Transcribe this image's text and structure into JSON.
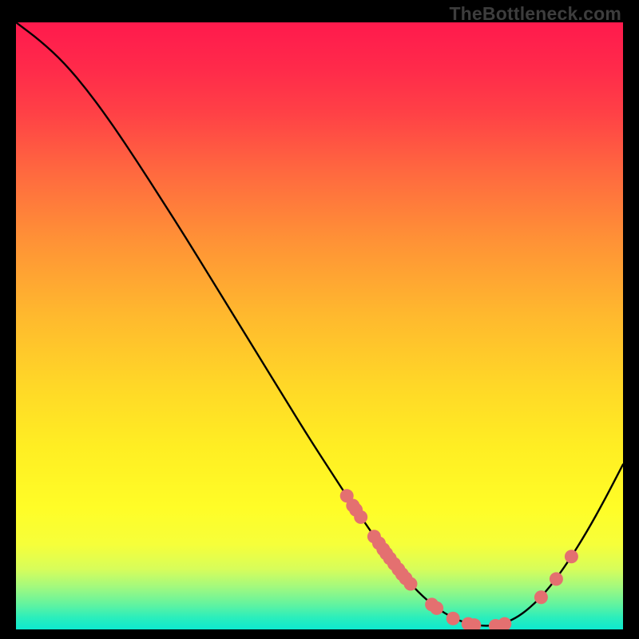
{
  "watermark": "TheBottleneck.com",
  "chart_data": {
    "type": "line",
    "title": "",
    "xlabel": "",
    "ylabel": "",
    "xlim": [
      0,
      100
    ],
    "ylim": [
      0,
      100
    ],
    "grid": false,
    "legend": false,
    "curve": [
      {
        "x": 0.0,
        "y": 100.0
      },
      {
        "x": 4.0,
        "y": 97.0
      },
      {
        "x": 8.0,
        "y": 93.3
      },
      {
        "x": 12.0,
        "y": 88.5
      },
      {
        "x": 16.0,
        "y": 83.0
      },
      {
        "x": 20.0,
        "y": 77.0
      },
      {
        "x": 24.0,
        "y": 70.8
      },
      {
        "x": 28.0,
        "y": 64.5
      },
      {
        "x": 32.0,
        "y": 58.0
      },
      {
        "x": 36.0,
        "y": 51.5
      },
      {
        "x": 40.0,
        "y": 45.0
      },
      {
        "x": 44.0,
        "y": 38.5
      },
      {
        "x": 48.0,
        "y": 32.0
      },
      {
        "x": 52.0,
        "y": 25.8
      },
      {
        "x": 55.0,
        "y": 21.2
      },
      {
        "x": 58.0,
        "y": 16.8
      },
      {
        "x": 61.0,
        "y": 12.5
      },
      {
        "x": 64.0,
        "y": 8.6
      },
      {
        "x": 67.0,
        "y": 5.4
      },
      {
        "x": 70.0,
        "y": 3.0
      },
      {
        "x": 73.0,
        "y": 1.4
      },
      {
        "x": 76.0,
        "y": 0.6
      },
      {
        "x": 79.0,
        "y": 0.6
      },
      {
        "x": 82.0,
        "y": 1.6
      },
      {
        "x": 85.0,
        "y": 3.8
      },
      {
        "x": 88.0,
        "y": 7.0
      },
      {
        "x": 91.0,
        "y": 11.2
      },
      {
        "x": 94.0,
        "y": 16.0
      },
      {
        "x": 97.0,
        "y": 21.4
      },
      {
        "x": 100.0,
        "y": 27.2
      }
    ],
    "markers": [
      {
        "x": 54.5,
        "y": 22.0
      },
      {
        "x": 55.5,
        "y": 20.4
      },
      {
        "x": 56.0,
        "y": 19.7
      },
      {
        "x": 56.8,
        "y": 18.5
      },
      {
        "x": 59.0,
        "y": 15.3
      },
      {
        "x": 59.8,
        "y": 14.2
      },
      {
        "x": 60.5,
        "y": 13.2
      },
      {
        "x": 61.0,
        "y": 12.5
      },
      {
        "x": 61.6,
        "y": 11.7
      },
      {
        "x": 62.3,
        "y": 10.8
      },
      {
        "x": 63.0,
        "y": 9.9
      },
      {
        "x": 63.6,
        "y": 9.1
      },
      {
        "x": 64.2,
        "y": 8.4
      },
      {
        "x": 65.0,
        "y": 7.5
      },
      {
        "x": 68.5,
        "y": 4.1
      },
      {
        "x": 69.3,
        "y": 3.5
      },
      {
        "x": 72.0,
        "y": 1.8
      },
      {
        "x": 74.5,
        "y": 0.9
      },
      {
        "x": 75.5,
        "y": 0.7
      },
      {
        "x": 79.0,
        "y": 0.6
      },
      {
        "x": 80.5,
        "y": 0.9
      },
      {
        "x": 86.5,
        "y": 5.3
      },
      {
        "x": 89.0,
        "y": 8.3
      },
      {
        "x": 91.5,
        "y": 12.0
      }
    ],
    "marker_color": "#e47070",
    "line_color": "#000000"
  }
}
